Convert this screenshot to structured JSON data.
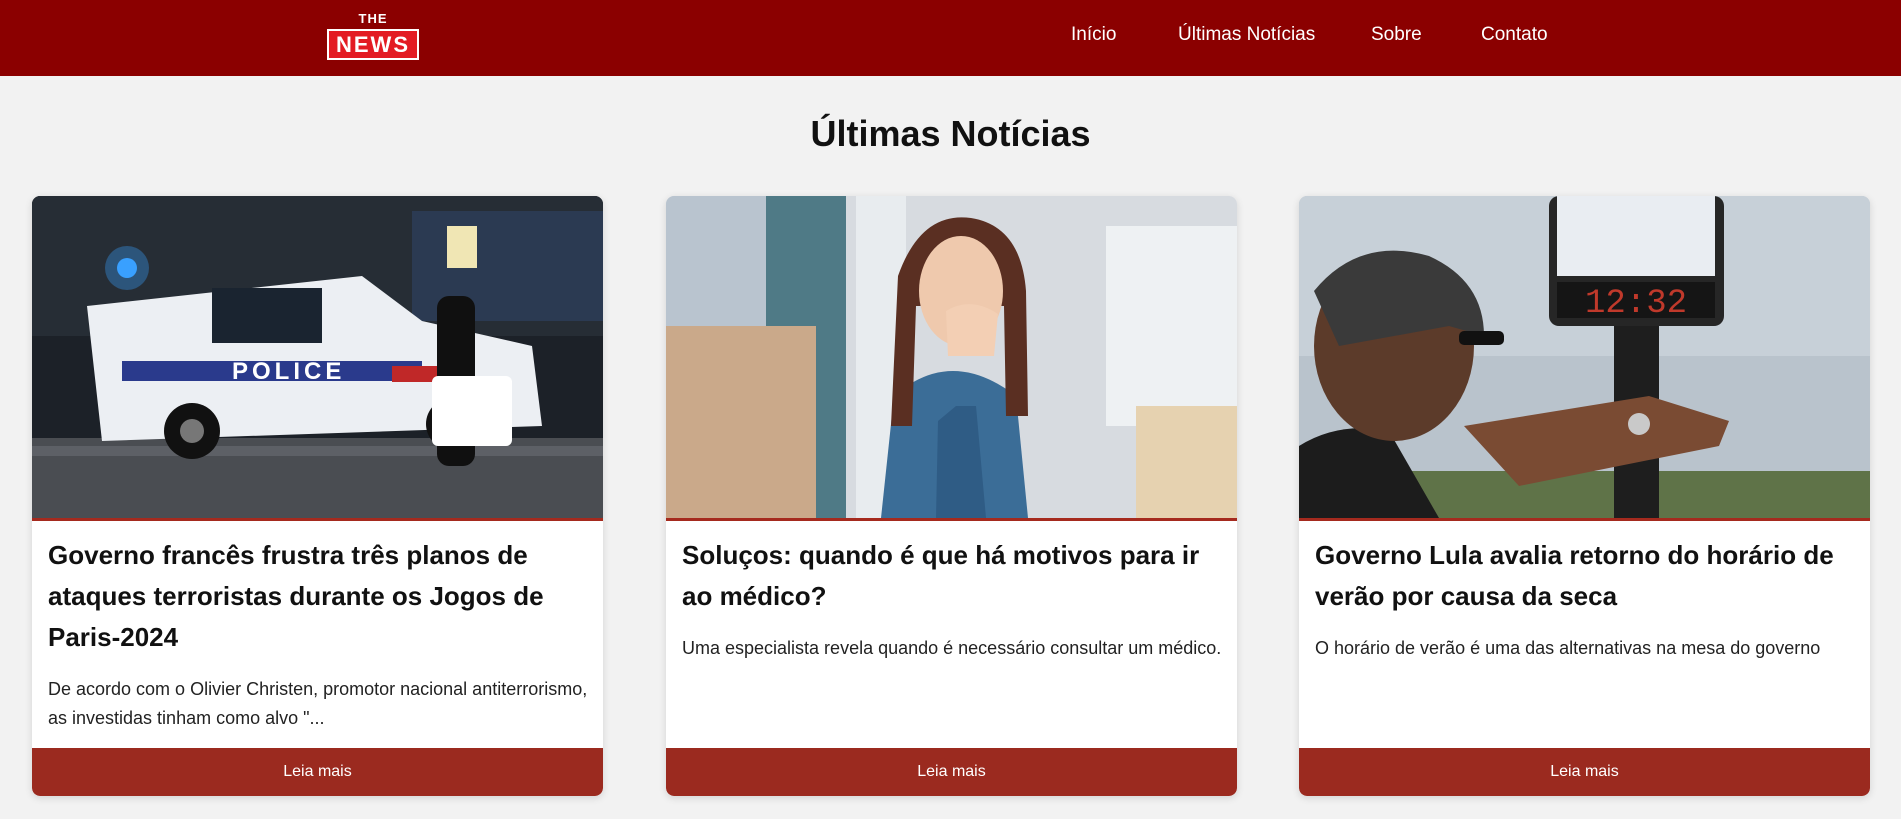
{
  "header": {
    "logo_top": "THE",
    "logo_bottom": "NEWS",
    "nav": [
      "Início",
      "Últimas Notícias",
      "Sobre",
      "Contato"
    ]
  },
  "main": {
    "title": "Últimas Notícias",
    "articles": [
      {
        "title": "Governo francês frustra três planos de ataques terroristas durante os Jogos de Paris-2024",
        "summary": "De acordo com o Olivier Christen, promotor nacional antiterrorismo, as investidas tinham como alvo \"...",
        "button": "Leia mais",
        "image_text": "POLICE"
      },
      {
        "title": "Soluços: quando é que há motivos para ir ao médico?",
        "summary": "Uma especialista revela quando é necessário consultar um médico.",
        "button": "Leia mais"
      },
      {
        "title": "Governo Lula avalia retorno do horário de verão por causa da seca",
        "summary": "O horário de verão é uma das alternativas na mesa do governo",
        "button": "Leia mais",
        "image_text": "12:32"
      }
    ]
  },
  "colors": {
    "header": "#8b0000",
    "logo_red": "#e31b23",
    "button": "#9b2a1f",
    "background": "#f2f2f2"
  }
}
